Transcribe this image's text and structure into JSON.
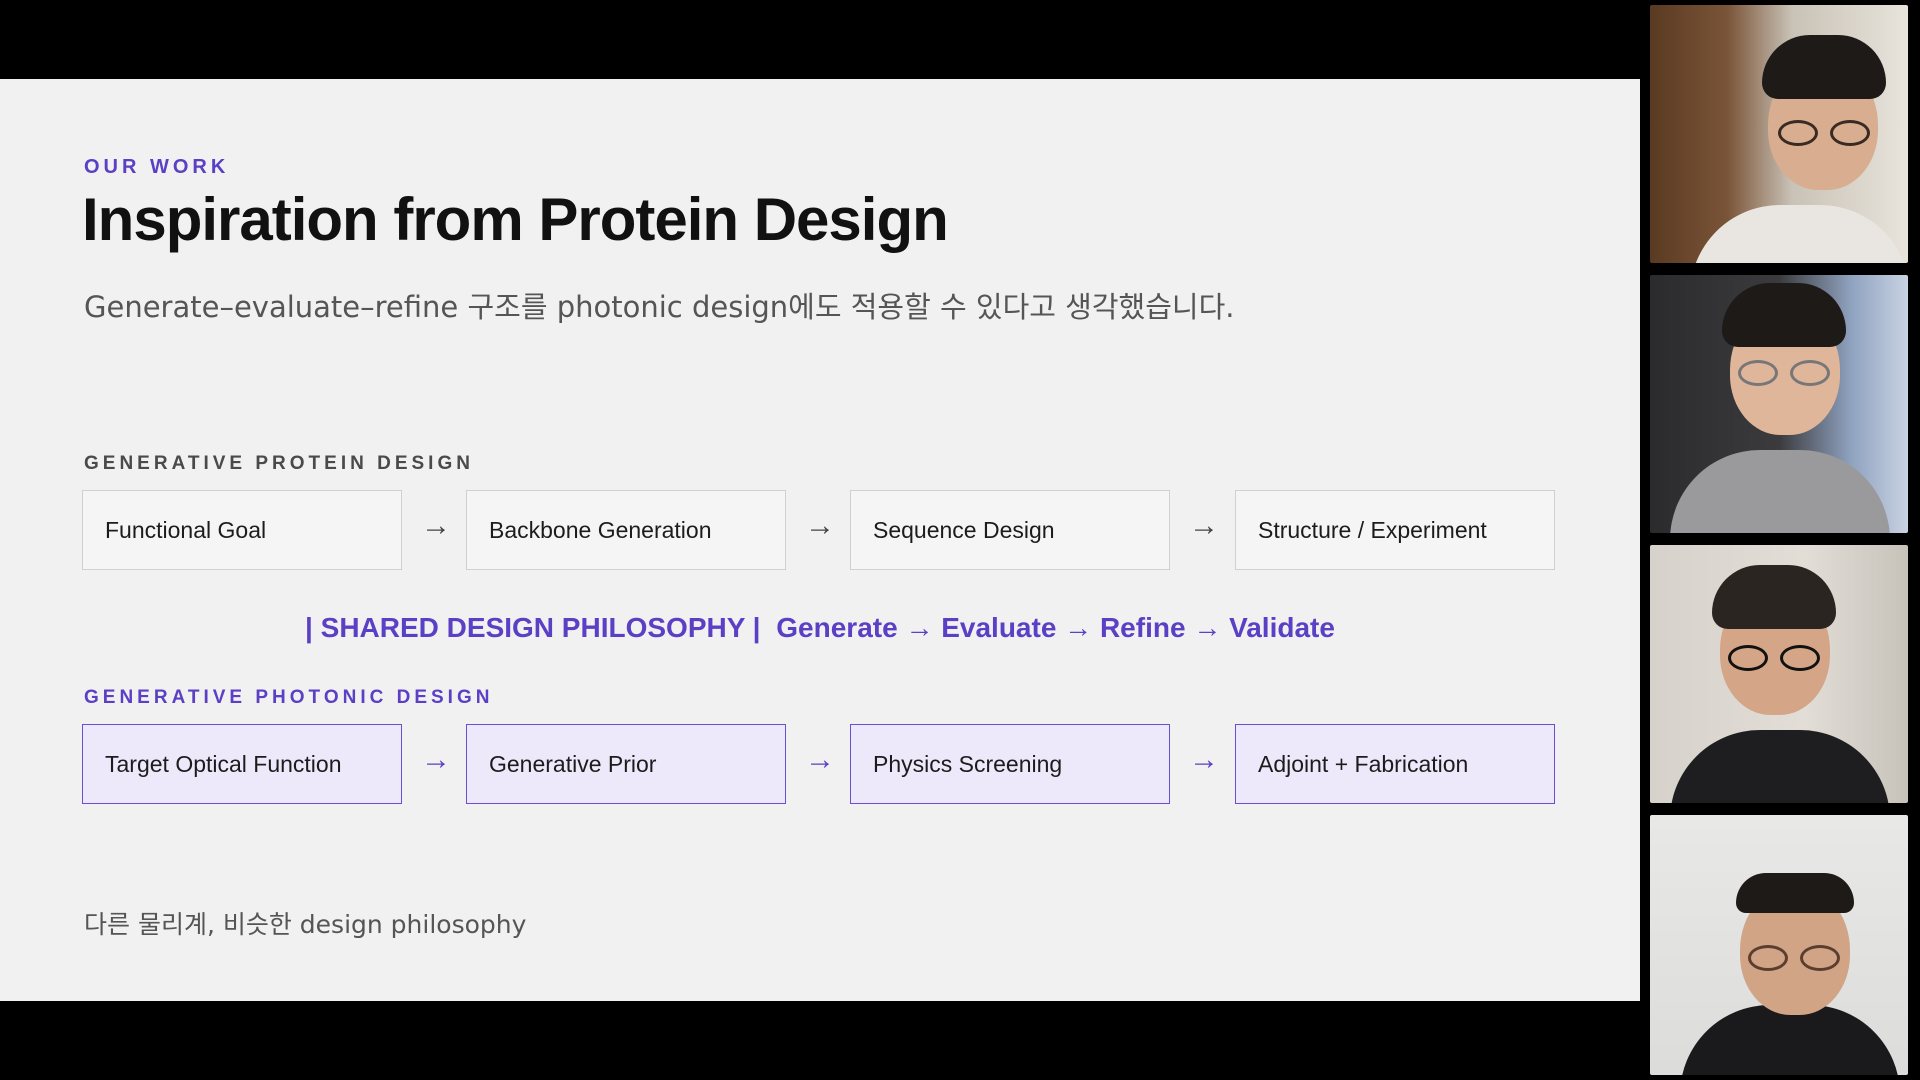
{
  "slide": {
    "eyebrow": "OUR WORK",
    "title": "Inspiration from Protein Design",
    "subtitle": "Generate–evaluate–refine 구조를 photonic design에도 적용할 수 있다고 생각했습니다.",
    "protein_section": {
      "label": "GENERATIVE PROTEIN DESIGN",
      "steps": [
        "Functional Goal",
        "Backbone Generation",
        "Sequence Design",
        "Structure / Experiment"
      ]
    },
    "philosophy": {
      "label": "| SHARED DESIGN PHILOSOPHY |",
      "flow": "Generate → Evaluate → Refine → Validate"
    },
    "photonic_section": {
      "label": "GENERATIVE PHOTONIC DESIGN",
      "steps": [
        "Target Optical Function",
        "Generative Prior",
        "Physics Screening",
        "Adjoint + Fabrication"
      ]
    },
    "arrow": "→",
    "footer_note": "다른 물리계, 비슷한 design philosophy"
  },
  "participants": [
    {
      "icon": "participant-video-icon"
    },
    {
      "icon": "participant-video-icon"
    },
    {
      "icon": "participant-video-icon"
    },
    {
      "icon": "participant-video-icon"
    }
  ],
  "colors": {
    "accent": "#5b3fc4",
    "slide_bg": "#f1f1f1",
    "photonic_box_bg": "#ede9fb"
  }
}
